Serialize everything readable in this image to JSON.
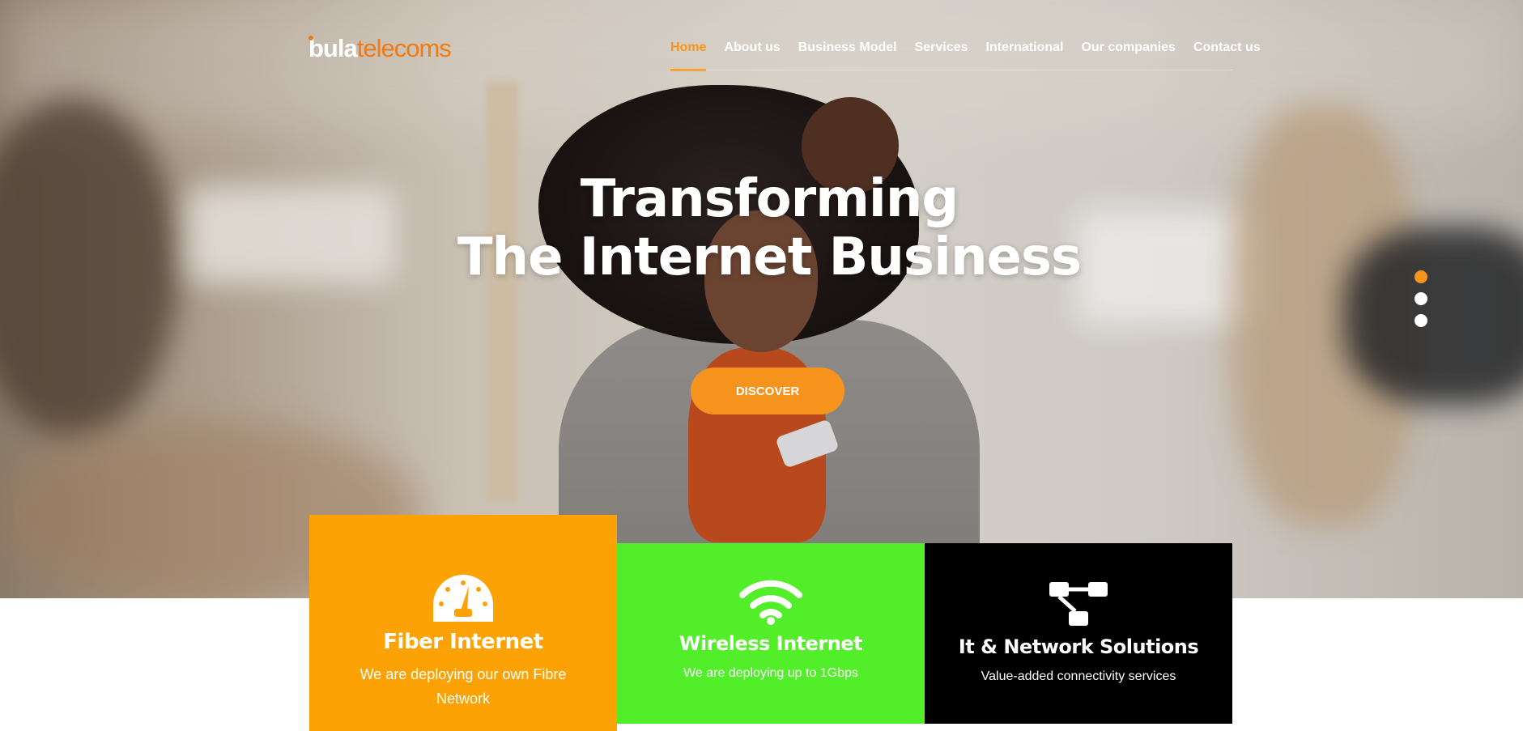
{
  "header": {
    "logo_part1": "bula",
    "logo_part2": "telecoms"
  },
  "nav": {
    "items": [
      {
        "label": "Home",
        "active": true
      },
      {
        "label": "About us"
      },
      {
        "label": "Business Model"
      },
      {
        "label": "Services"
      },
      {
        "label": "International"
      },
      {
        "label": "Our companies"
      },
      {
        "label": "Contact us"
      }
    ]
  },
  "hero": {
    "headline_line1": "Transforming",
    "headline_line2": "The Internet Business",
    "button_label": "DISCOVER",
    "slides_total": 3,
    "active_slide": 1
  },
  "cards": [
    {
      "title": "Fiber Internet",
      "desc": "We are deploying our own Fibre Network",
      "icon": "speedometer-icon",
      "color": "#fda204"
    },
    {
      "title": "Wireless Internet",
      "desc": "We are deploying up to 1Gbps",
      "icon": "wifi-icon",
      "color": "#52ee29"
    },
    {
      "title": "It & Network Solutions",
      "desc": "Value-added connectivity services",
      "icon": "network-icon",
      "color": "#000000"
    }
  ],
  "colors": {
    "accent": "#f7941d",
    "logo_orange": "#f07a12"
  }
}
